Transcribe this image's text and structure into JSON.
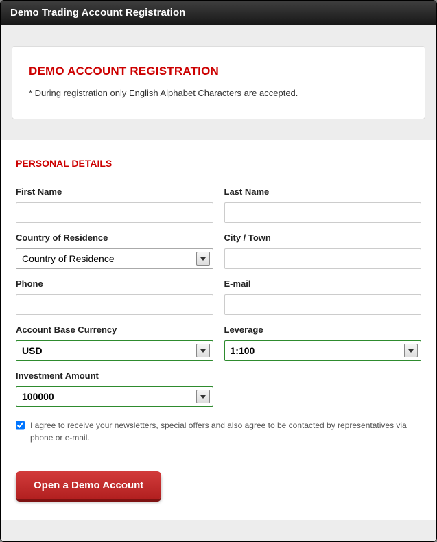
{
  "window": {
    "title": "Demo Trading Account Registration"
  },
  "notice": {
    "title": "DEMO ACCOUNT REGISTRATION",
    "text": "* During registration only English Alphabet Characters are accepted."
  },
  "section": {
    "personal_details": "PERSONAL DETAILS"
  },
  "labels": {
    "first_name": "First Name",
    "last_name": "Last Name",
    "country": "Country of Residence",
    "city": "City / Town",
    "phone": "Phone",
    "email": "E-mail",
    "currency": "Account Base Currency",
    "leverage": "Leverage",
    "investment": "Investment Amount"
  },
  "values": {
    "first_name": "",
    "last_name": "",
    "country": "Country of Residence",
    "city": "",
    "phone": "",
    "email": "",
    "currency": "USD",
    "leverage": "1:100",
    "investment": "100000"
  },
  "consent": {
    "checked": true,
    "text": "I agree to receive your newsletters, special offers and also agree to be contacted by representatives via phone or e-mail."
  },
  "submit": {
    "label": "Open a Demo Account"
  }
}
